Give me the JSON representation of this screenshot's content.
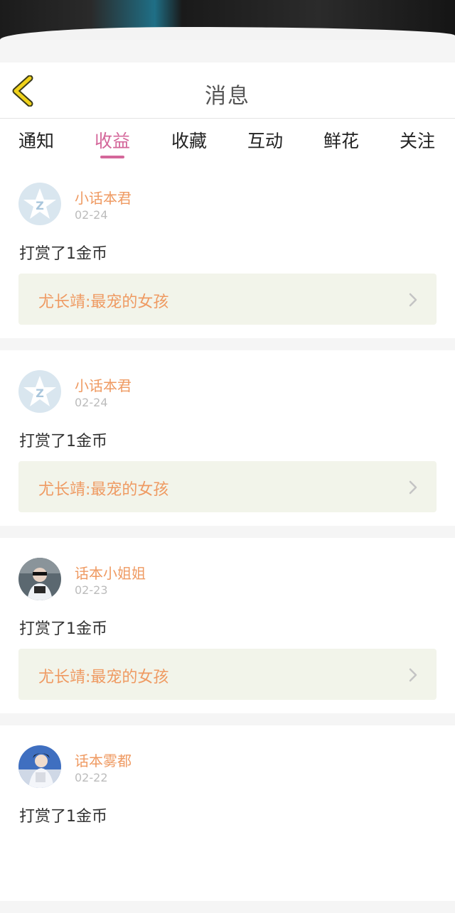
{
  "header": {
    "title": "消息"
  },
  "tabs": [
    {
      "label": "通知"
    },
    {
      "label": "收益"
    },
    {
      "label": "收藏"
    },
    {
      "label": "互动"
    },
    {
      "label": "鲜花"
    },
    {
      "label": "关注"
    }
  ],
  "active_tab": "收益",
  "colors": {
    "accent": "#d4679a",
    "username": "#ef9a62",
    "book_bg": "#f2f4ea"
  },
  "messages": [
    {
      "username": "小话本君",
      "date": "02-24",
      "action": "打赏了1金币",
      "book": "尤长靖:最宠的女孩",
      "avatar": "default-logo"
    },
    {
      "username": "小话本君",
      "date": "02-24",
      "action": "打赏了1金币",
      "book": "尤长靖:最宠的女孩",
      "avatar": "default-logo"
    },
    {
      "username": "话本小姐姐",
      "date": "02-23",
      "action": "打赏了1金币",
      "book": "尤长靖:最宠的女孩",
      "avatar": "photo"
    },
    {
      "username": "话本雾都",
      "date": "02-22",
      "action": "打赏了1金币",
      "book": "",
      "avatar": "photo"
    }
  ]
}
